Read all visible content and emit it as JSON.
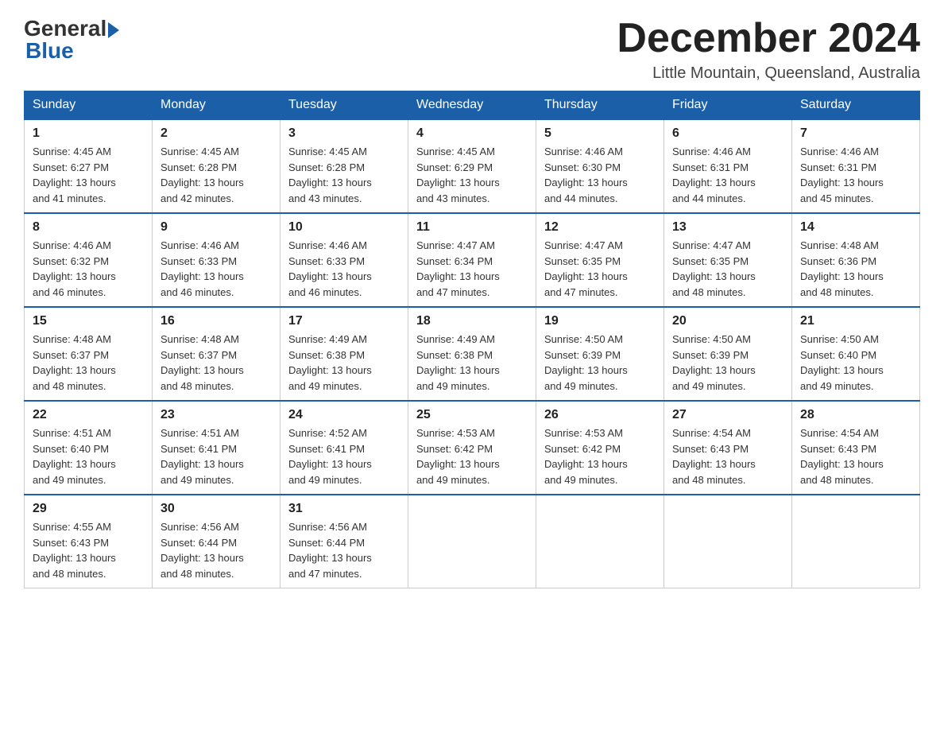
{
  "header": {
    "logo_general": "General",
    "logo_blue": "Blue",
    "month_title": "December 2024",
    "subtitle": "Little Mountain, Queensland, Australia"
  },
  "weekdays": [
    "Sunday",
    "Monday",
    "Tuesday",
    "Wednesday",
    "Thursday",
    "Friday",
    "Saturday"
  ],
  "weeks": [
    [
      {
        "day": "1",
        "sunrise": "4:45 AM",
        "sunset": "6:27 PM",
        "daylight": "13 hours and 41 minutes."
      },
      {
        "day": "2",
        "sunrise": "4:45 AM",
        "sunset": "6:28 PM",
        "daylight": "13 hours and 42 minutes."
      },
      {
        "day": "3",
        "sunrise": "4:45 AM",
        "sunset": "6:28 PM",
        "daylight": "13 hours and 43 minutes."
      },
      {
        "day": "4",
        "sunrise": "4:45 AM",
        "sunset": "6:29 PM",
        "daylight": "13 hours and 43 minutes."
      },
      {
        "day": "5",
        "sunrise": "4:46 AM",
        "sunset": "6:30 PM",
        "daylight": "13 hours and 44 minutes."
      },
      {
        "day": "6",
        "sunrise": "4:46 AM",
        "sunset": "6:31 PM",
        "daylight": "13 hours and 44 minutes."
      },
      {
        "day": "7",
        "sunrise": "4:46 AM",
        "sunset": "6:31 PM",
        "daylight": "13 hours and 45 minutes."
      }
    ],
    [
      {
        "day": "8",
        "sunrise": "4:46 AM",
        "sunset": "6:32 PM",
        "daylight": "13 hours and 46 minutes."
      },
      {
        "day": "9",
        "sunrise": "4:46 AM",
        "sunset": "6:33 PM",
        "daylight": "13 hours and 46 minutes."
      },
      {
        "day": "10",
        "sunrise": "4:46 AM",
        "sunset": "6:33 PM",
        "daylight": "13 hours and 46 minutes."
      },
      {
        "day": "11",
        "sunrise": "4:47 AM",
        "sunset": "6:34 PM",
        "daylight": "13 hours and 47 minutes."
      },
      {
        "day": "12",
        "sunrise": "4:47 AM",
        "sunset": "6:35 PM",
        "daylight": "13 hours and 47 minutes."
      },
      {
        "day": "13",
        "sunrise": "4:47 AM",
        "sunset": "6:35 PM",
        "daylight": "13 hours and 48 minutes."
      },
      {
        "day": "14",
        "sunrise": "4:48 AM",
        "sunset": "6:36 PM",
        "daylight": "13 hours and 48 minutes."
      }
    ],
    [
      {
        "day": "15",
        "sunrise": "4:48 AM",
        "sunset": "6:37 PM",
        "daylight": "13 hours and 48 minutes."
      },
      {
        "day": "16",
        "sunrise": "4:48 AM",
        "sunset": "6:37 PM",
        "daylight": "13 hours and 48 minutes."
      },
      {
        "day": "17",
        "sunrise": "4:49 AM",
        "sunset": "6:38 PM",
        "daylight": "13 hours and 49 minutes."
      },
      {
        "day": "18",
        "sunrise": "4:49 AM",
        "sunset": "6:38 PM",
        "daylight": "13 hours and 49 minutes."
      },
      {
        "day": "19",
        "sunrise": "4:50 AM",
        "sunset": "6:39 PM",
        "daylight": "13 hours and 49 minutes."
      },
      {
        "day": "20",
        "sunrise": "4:50 AM",
        "sunset": "6:39 PM",
        "daylight": "13 hours and 49 minutes."
      },
      {
        "day": "21",
        "sunrise": "4:50 AM",
        "sunset": "6:40 PM",
        "daylight": "13 hours and 49 minutes."
      }
    ],
    [
      {
        "day": "22",
        "sunrise": "4:51 AM",
        "sunset": "6:40 PM",
        "daylight": "13 hours and 49 minutes."
      },
      {
        "day": "23",
        "sunrise": "4:51 AM",
        "sunset": "6:41 PM",
        "daylight": "13 hours and 49 minutes."
      },
      {
        "day": "24",
        "sunrise": "4:52 AM",
        "sunset": "6:41 PM",
        "daylight": "13 hours and 49 minutes."
      },
      {
        "day": "25",
        "sunrise": "4:53 AM",
        "sunset": "6:42 PM",
        "daylight": "13 hours and 49 minutes."
      },
      {
        "day": "26",
        "sunrise": "4:53 AM",
        "sunset": "6:42 PM",
        "daylight": "13 hours and 49 minutes."
      },
      {
        "day": "27",
        "sunrise": "4:54 AM",
        "sunset": "6:43 PM",
        "daylight": "13 hours and 48 minutes."
      },
      {
        "day": "28",
        "sunrise": "4:54 AM",
        "sunset": "6:43 PM",
        "daylight": "13 hours and 48 minutes."
      }
    ],
    [
      {
        "day": "29",
        "sunrise": "4:55 AM",
        "sunset": "6:43 PM",
        "daylight": "13 hours and 48 minutes."
      },
      {
        "day": "30",
        "sunrise": "4:56 AM",
        "sunset": "6:44 PM",
        "daylight": "13 hours and 48 minutes."
      },
      {
        "day": "31",
        "sunrise": "4:56 AM",
        "sunset": "6:44 PM",
        "daylight": "13 hours and 47 minutes."
      },
      null,
      null,
      null,
      null
    ]
  ],
  "labels": {
    "sunrise_prefix": "Sunrise: ",
    "sunset_prefix": "Sunset: ",
    "daylight_prefix": "Daylight: "
  }
}
